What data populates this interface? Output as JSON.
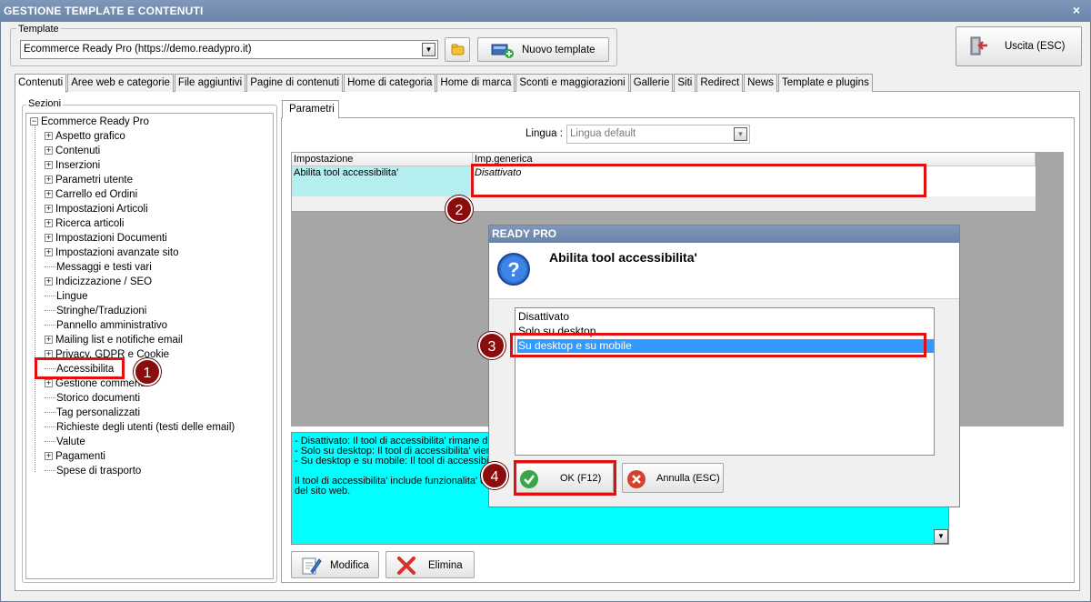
{
  "window": {
    "title": "GESTIONE TEMPLATE E CONTENUTI",
    "close_glyph": "×"
  },
  "template": {
    "legend": "Template",
    "selected": "Ecommerce Ready Pro (https://demo.readypro.it)",
    "new_button": "Nuovo template"
  },
  "exit_button": "Uscita (ESC)",
  "tabs": [
    {
      "label": "Contenuti",
      "active": true
    },
    {
      "label": "Aree web e categorie"
    },
    {
      "label": "File aggiuntivi"
    },
    {
      "label": "Pagine di contenuti"
    },
    {
      "label": "Home di categoria"
    },
    {
      "label": "Home di marca"
    },
    {
      "label": "Sconti e maggiorazioni"
    },
    {
      "label": "Gallerie"
    },
    {
      "label": "Siti"
    },
    {
      "label": "Redirect"
    },
    {
      "label": "News"
    },
    {
      "label": "Template e plugins"
    }
  ],
  "sections": {
    "legend": "Sezioni",
    "root": "Ecommerce Ready Pro",
    "items": [
      {
        "label": "Aspetto grafico",
        "expandable": true
      },
      {
        "label": "Contenuti",
        "expandable": true
      },
      {
        "label": "Inserzioni",
        "expandable": true
      },
      {
        "label": "Parametri utente",
        "expandable": true
      },
      {
        "label": "Carrello ed Ordini",
        "expandable": true
      },
      {
        "label": "Impostazioni Articoli",
        "expandable": true
      },
      {
        "label": "Ricerca articoli",
        "expandable": true
      },
      {
        "label": "Impostazioni Documenti",
        "expandable": true
      },
      {
        "label": "Impostazioni avanzate sito",
        "expandable": true
      },
      {
        "label": "Messaggi e testi vari",
        "expandable": false
      },
      {
        "label": "Indicizzazione / SEO",
        "expandable": true
      },
      {
        "label": "Lingue",
        "expandable": false
      },
      {
        "label": "Stringhe/Traduzioni",
        "expandable": false
      },
      {
        "label": "Pannello amministrativo",
        "expandable": false
      },
      {
        "label": "Mailing list e notifiche email",
        "expandable": true
      },
      {
        "label": "Privacy, GDPR e Cookie",
        "expandable": true
      },
      {
        "label": "Accessibilita",
        "expandable": false,
        "selected": true
      },
      {
        "label": "Gestione commenti",
        "expandable": true
      },
      {
        "label": "Storico documenti",
        "expandable": false
      },
      {
        "label": "Tag personalizzati",
        "expandable": false
      },
      {
        "label": "Richieste degli utenti (testi delle email)",
        "expandable": false
      },
      {
        "label": "Valute",
        "expandable": false
      },
      {
        "label": "Pagamenti",
        "expandable": true
      },
      {
        "label": "Spese di trasporto",
        "expandable": false
      }
    ]
  },
  "parametri": {
    "tab_label": "Parametri",
    "lingua_label": "Lingua :",
    "lingua_value": "Lingua default",
    "grid": {
      "headers": [
        "Impostazione",
        "Imp.generica"
      ],
      "row": {
        "setting": "Abilita tool accessibilita'",
        "value": "Disattivato"
      }
    },
    "description_lines": [
      "- Disattivato: Il tool di accessibilita' rimane dis",
      "- Solo su desktop: Il tool di accessibilita' viene",
      "- Su desktop e su mobile: Il tool di accessibili",
      "",
      "Il tool di accessibilita' include funzionalita' com",
      "del sito web."
    ],
    "modify_button": "Modifica",
    "delete_button": "Elimina"
  },
  "dialog": {
    "title": "READY PRO",
    "question": "Abilita tool accessibilita'",
    "options": [
      "Disattivato",
      "Solo su desktop",
      "Su desktop e su mobile"
    ],
    "selected_index": 2,
    "ok_button": "OK (F12)",
    "cancel_button": "Annulla (ESC)"
  },
  "markers": [
    "1",
    "2",
    "3",
    "4"
  ],
  "colors": {
    "highlight": "#e01010",
    "marker": "#8b0c0c",
    "selection": "#3399ff",
    "description_bg": "#00ffff"
  }
}
